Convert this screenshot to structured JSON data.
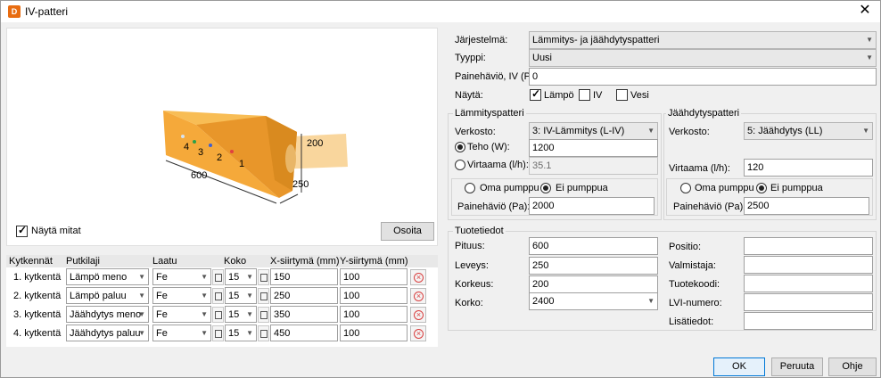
{
  "window": {
    "title": "IV-patteri",
    "icon_letter": "D",
    "close": "✕"
  },
  "preview": {
    "dims": {
      "width": "600",
      "height": "200",
      "depth": "250"
    },
    "connectors": [
      "4",
      "3",
      "2",
      "1"
    ],
    "show_dims_label": "Näytä mitat",
    "show_dims_checked": true,
    "point_button": "Osoita"
  },
  "connections": {
    "headers": {
      "conn": "Kytkennät",
      "pipe": "Putkilaji",
      "quality": "Laatu",
      "size": "Koko",
      "xoff": "X-siirtymä (mm)",
      "yoff": "Y-siirtymä (mm)"
    },
    "rows": [
      {
        "name": "1. kytkentä",
        "pipe": "Lämpö meno",
        "quality": "Fe",
        "size": "15",
        "x": "150",
        "y": "100"
      },
      {
        "name": "2. kytkentä",
        "pipe": "Lämpö paluu",
        "quality": "Fe",
        "size": "15",
        "x": "250",
        "y": "100"
      },
      {
        "name": "3. kytkentä",
        "pipe": "Jäähdytys meno",
        "quality": "Fe",
        "size": "15",
        "x": "350",
        "y": "100"
      },
      {
        "name": "4. kytkentä",
        "pipe": "Jäähdytys paluu",
        "quality": "Fe",
        "size": "15",
        "x": "450",
        "y": "100"
      }
    ]
  },
  "general": {
    "system_label": "Järjestelmä:",
    "system_value": "Lämmitys- ja jäähdytyspatteri",
    "type_label": "Tyyppi:",
    "type_value": "Uusi",
    "pd_label": "Painehäviö, IV (Pa):",
    "pd_value": "0",
    "show_label": "Näytä:",
    "show_heat": "Lämpö",
    "show_iv": "IV",
    "show_water": "Vesi"
  },
  "heating": {
    "title": "Lämmityspatteri",
    "network_label": "Verkosto:",
    "network_value": "3: IV-Lämmitys (L-IV)",
    "power_label": "Teho (W):",
    "power_value": "1200",
    "flow_label": "Virtaama (l/h):",
    "flow_value": "35.1",
    "own_pump": "Oma pumppu",
    "no_pump": "Ei pumppua",
    "pd_label": "Painehäviö (Pa):",
    "pd_value": "2000"
  },
  "cooling": {
    "title": "Jäähdytyspatteri",
    "network_label": "Verkosto:",
    "network_value": "5: Jäähdytys (LL)",
    "flow_label": "Virtaama (l/h):",
    "flow_value": "120",
    "own_pump": "Oma pumppu",
    "no_pump": "Ei pumppua",
    "pd_label": "Painehäviö (Pa):",
    "pd_value": "2500"
  },
  "product": {
    "title": "Tuotetiedot",
    "length_label": "Pituus:",
    "length_value": "600",
    "width_label": "Leveys:",
    "width_value": "250",
    "height_label": "Korkeus:",
    "height_value": "200",
    "elevation_label": "Korko:",
    "elevation_value": "2400",
    "position_label": "Positio:",
    "position_value": "",
    "maker_label": "Valmistaja:",
    "maker_value": "",
    "code_label": "Tuotekoodi:",
    "code_value": "",
    "lvi_label": "LVI-numero:",
    "lvi_value": "",
    "extra_label": "Lisätiedot:",
    "extra_value": ""
  },
  "footer": {
    "ok": "OK",
    "cancel": "Peruuta",
    "help": "Ohje"
  },
  "colors": {
    "box": "#f5a93a",
    "box_dark": "#e08c1c",
    "pipe": "#f8cf8c",
    "accent": "#0078d7"
  }
}
